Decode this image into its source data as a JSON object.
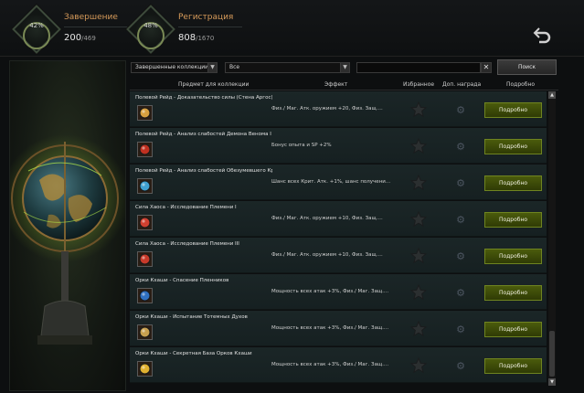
{
  "header": {
    "completion": {
      "percent": "42%",
      "label": "Завершение",
      "value": "200",
      "total": "/469"
    },
    "registration": {
      "percent": "48%",
      "label": "Регистрация",
      "value": "808",
      "total": "/1670"
    }
  },
  "filters": {
    "category_value": "Завершенные коллекции",
    "type_value": "Все",
    "search_value": "",
    "clear_label": "✕",
    "search_label": "Поиск"
  },
  "columns": {
    "item": "Предмет для коллекции",
    "effect": "Эффект",
    "favorite": "Избранное",
    "reward": "Доп. награда",
    "details": "Подробно"
  },
  "rows": [
    {
      "title": "Полевой Рейд - Доказательство силы (Стена Аргос)",
      "effect": "Физ./ Маг. Атк. оружием +20, Физ. Защ....",
      "icon": "scroll-icon",
      "icon_color": "#d8a040",
      "detail": "Подробно"
    },
    {
      "title": "Полевой Рейд - Анализ слабостей Демона Венома I",
      "effect": "Бонус опыта и SP +2%",
      "icon": "red-crystal-icon",
      "icon_color": "#c03020",
      "detail": "Подробно"
    },
    {
      "title": "Полевой Рейд - Анализ слабостей Обезумевшего Кр",
      "effect": "Шанс всех Крит. Атк. +1%, шанс получени...",
      "icon": "blue-gem-icon",
      "icon_color": "#40a0d0",
      "detail": "Подробно"
    },
    {
      "title": "Сила Хаоса - Исследование Племени I",
      "effect": "Физ./ Маг. Атк. оружием +10, Физ. Защ....",
      "icon": "red-orb-icon",
      "icon_color": "#d04030",
      "detail": "Подробно"
    },
    {
      "title": "Сила Хаоса - Исследование Племени III",
      "effect": "Физ./ Маг. Атк. оружием +10, Физ. Защ....",
      "icon": "red-orb-icon",
      "icon_color": "#c83a2a",
      "detail": "Подробно"
    },
    {
      "title": "Орки Кхаши - Спасение Пленников",
      "effect": "Мощность всех атак +3%, Физ./ Маг. Защ....",
      "icon": "blue-rune-icon",
      "icon_color": "#3070c0",
      "detail": "Подробно"
    },
    {
      "title": "Орки Кхаши - Испытание Тотемных Духов",
      "effect": "Мощность всех атак +3%, Физ./ Маг. Защ....",
      "icon": "totem-icon",
      "icon_color": "#c8a050",
      "detail": "Подробно"
    },
    {
      "title": "Орки Кхаши - Секретная База Орков Кхаши",
      "effect": "Мощность всех атак +3%, Физ./ Маг. Защ....",
      "icon": "gold-coin-icon",
      "icon_color": "#e0b030",
      "detail": "Подробно"
    }
  ],
  "colors": {
    "accent_orange": "#d79b5a",
    "button_green": "#4b5b0c",
    "row_bg": "#1b2627"
  }
}
